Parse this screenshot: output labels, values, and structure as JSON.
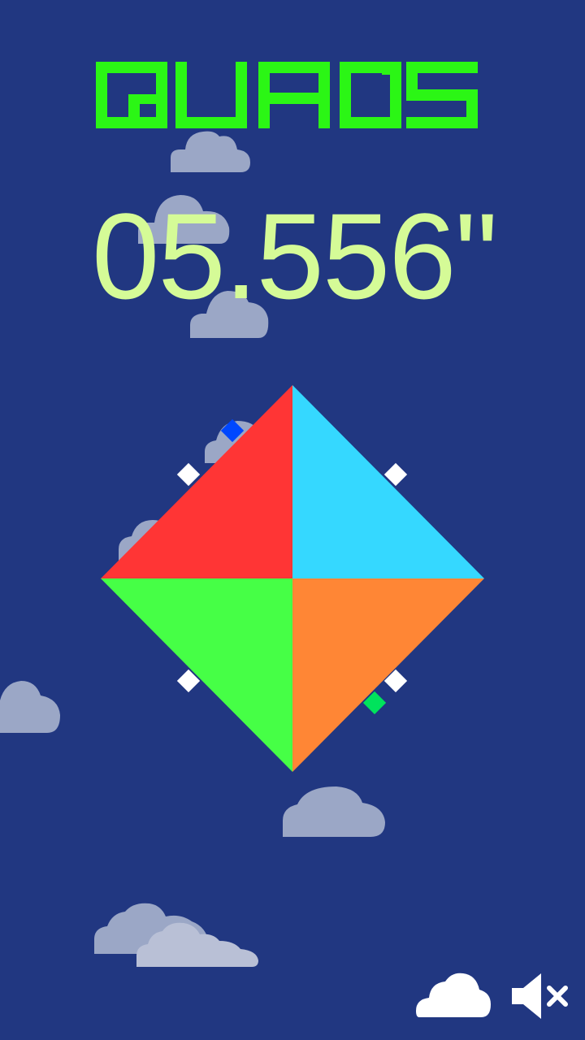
{
  "game": {
    "title": "QUADS",
    "timer": "05.556\""
  },
  "colors": {
    "background": "#213781",
    "title_color": "#2bf615",
    "timer_color": "#d5fb97",
    "quadrant_top_left": "#ff3535",
    "quadrant_top_right": "#35d8ff",
    "quadrant_bottom_left": "#46ff46",
    "quadrant_bottom_right": "#ff8635",
    "marker_white": "#ffffff",
    "marker_blue": "#0047ff",
    "marker_green": "#00e35c"
  },
  "controls": {
    "cloud_icon": "cloud-icon",
    "sound_icon": "speaker-muted-icon"
  }
}
